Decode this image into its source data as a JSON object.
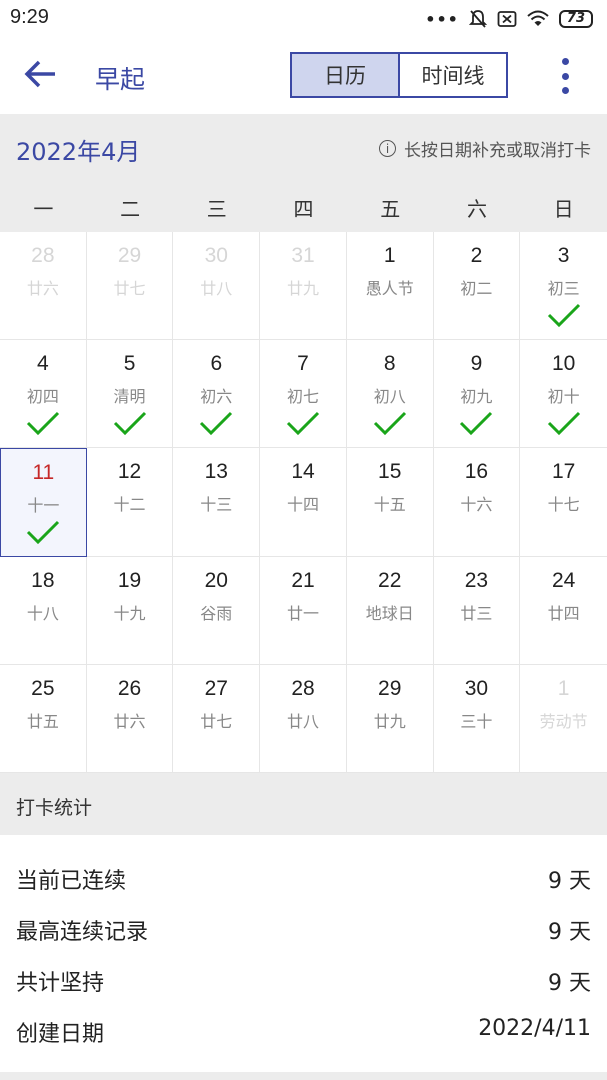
{
  "status_bar": {
    "time": "9:29",
    "battery": "73"
  },
  "app_bar": {
    "title": "早起",
    "tabs": [
      "日历",
      "时间线"
    ],
    "active_tab": "日历"
  },
  "calendar": {
    "month_title": "2022年4月",
    "hint": "长按日期补充或取消打卡",
    "weekdays": [
      "一",
      "二",
      "三",
      "四",
      "五",
      "六",
      "日"
    ],
    "days": [
      {
        "day": "28",
        "lunar": "廿六",
        "dim": true,
        "checked": false
      },
      {
        "day": "29",
        "lunar": "廿七",
        "dim": true,
        "checked": false
      },
      {
        "day": "30",
        "lunar": "廿八",
        "dim": true,
        "checked": false
      },
      {
        "day": "31",
        "lunar": "廿九",
        "dim": true,
        "checked": false
      },
      {
        "day": "1",
        "lunar": "愚人节",
        "dim": false,
        "checked": false
      },
      {
        "day": "2",
        "lunar": "初二",
        "dim": false,
        "checked": false
      },
      {
        "day": "3",
        "lunar": "初三",
        "dim": false,
        "checked": true
      },
      {
        "day": "4",
        "lunar": "初四",
        "dim": false,
        "checked": true
      },
      {
        "day": "5",
        "lunar": "清明",
        "dim": false,
        "checked": true
      },
      {
        "day": "6",
        "lunar": "初六",
        "dim": false,
        "checked": true
      },
      {
        "day": "7",
        "lunar": "初七",
        "dim": false,
        "checked": true
      },
      {
        "day": "8",
        "lunar": "初八",
        "dim": false,
        "checked": true
      },
      {
        "day": "9",
        "lunar": "初九",
        "dim": false,
        "checked": true
      },
      {
        "day": "10",
        "lunar": "初十",
        "dim": false,
        "checked": true
      },
      {
        "day": "11",
        "lunar": "十一",
        "dim": false,
        "checked": true,
        "today": true
      },
      {
        "day": "12",
        "lunar": "十二",
        "dim": false,
        "checked": false
      },
      {
        "day": "13",
        "lunar": "十三",
        "dim": false,
        "checked": false
      },
      {
        "day": "14",
        "lunar": "十四",
        "dim": false,
        "checked": false
      },
      {
        "day": "15",
        "lunar": "十五",
        "dim": false,
        "checked": false
      },
      {
        "day": "16",
        "lunar": "十六",
        "dim": false,
        "checked": false
      },
      {
        "day": "17",
        "lunar": "十七",
        "dim": false,
        "checked": false
      },
      {
        "day": "18",
        "lunar": "十八",
        "dim": false,
        "checked": false
      },
      {
        "day": "19",
        "lunar": "十九",
        "dim": false,
        "checked": false
      },
      {
        "day": "20",
        "lunar": "谷雨",
        "dim": false,
        "checked": false
      },
      {
        "day": "21",
        "lunar": "廿一",
        "dim": false,
        "checked": false
      },
      {
        "day": "22",
        "lunar": "地球日",
        "dim": false,
        "checked": false
      },
      {
        "day": "23",
        "lunar": "廿三",
        "dim": false,
        "checked": false
      },
      {
        "day": "24",
        "lunar": "廿四",
        "dim": false,
        "checked": false
      },
      {
        "day": "25",
        "lunar": "廿五",
        "dim": false,
        "checked": false
      },
      {
        "day": "26",
        "lunar": "廿六",
        "dim": false,
        "checked": false
      },
      {
        "day": "27",
        "lunar": "廿七",
        "dim": false,
        "checked": false
      },
      {
        "day": "28",
        "lunar": "廿八",
        "dim": false,
        "checked": false
      },
      {
        "day": "29",
        "lunar": "廿九",
        "dim": false,
        "checked": false
      },
      {
        "day": "30",
        "lunar": "三十",
        "dim": false,
        "checked": false
      },
      {
        "day": "1",
        "lunar": "劳动节",
        "dim": true,
        "checked": false
      }
    ]
  },
  "stats": {
    "title": "打卡统计",
    "rows": [
      {
        "label": "当前已连续",
        "value": "9 天"
      },
      {
        "label": "最高连续记录",
        "value": "9 天"
      },
      {
        "label": "共计坚持",
        "value": "9 天"
      },
      {
        "label": "创建日期",
        "value": "2022/4/11"
      }
    ]
  },
  "colors": {
    "accent": "#3b48a4",
    "check": "#1aa51a",
    "today_number": "#c62828"
  },
  "icons": {
    "back": "arrow-left-icon",
    "more": "more-vertical-icon",
    "info": "info-icon",
    "check": "check-icon"
  }
}
